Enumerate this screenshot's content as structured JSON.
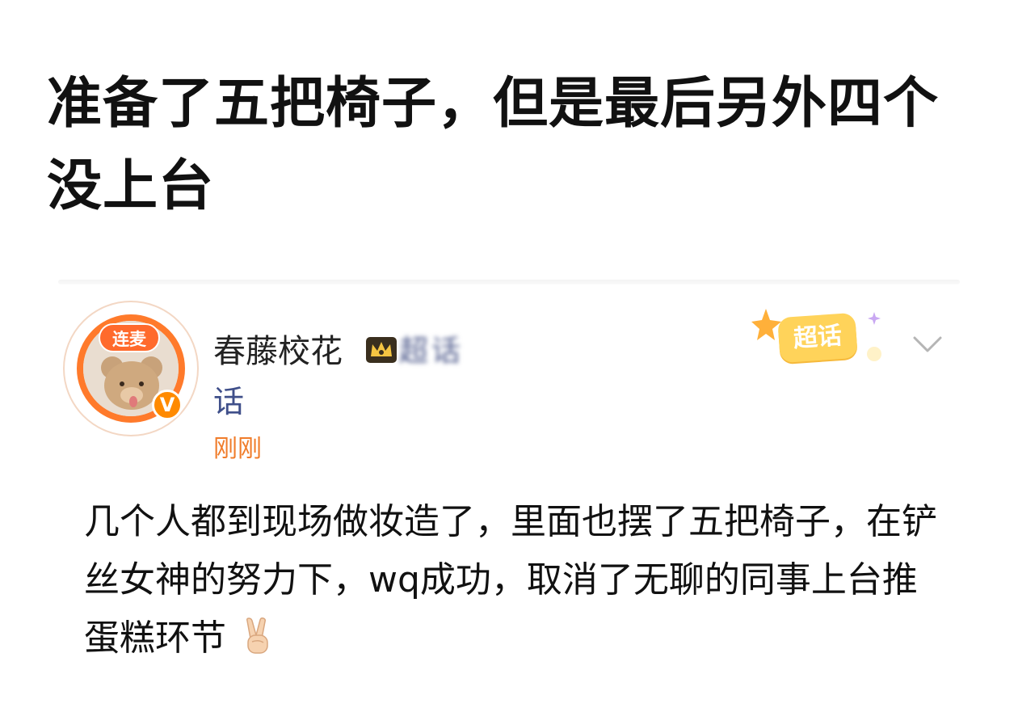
{
  "headline": "准备了五把椅子，但是最后另外四个没上台",
  "post": {
    "live_badge": "连麦",
    "verified_mark": "V",
    "user_name": "春藤校花",
    "blurred_tag": "超话",
    "topic_tail": "话",
    "time": "刚刚",
    "supertopic_label": "超话",
    "body": "几个人都到现场做妆造了，里面也摆了五把椅子，在铲丝女神的努力下，wq成功，取消了无聊的同事上台推蛋糕环节",
    "body_emoji": "victory-hand-icon"
  },
  "colors": {
    "accent_orange": "#ff6a2c",
    "time_orange": "#f07c2a",
    "topic_blue": "#3f4f8a",
    "supertopic_yellow": "#ffd35a"
  }
}
